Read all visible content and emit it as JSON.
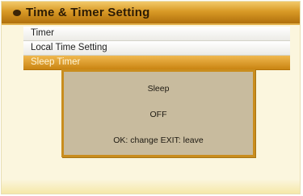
{
  "header": {
    "title": "Time & Timer Setting"
  },
  "menu": {
    "items": [
      {
        "label": "Timer"
      },
      {
        "label": "Local Time Setting"
      },
      {
        "label": "Sleep Timer"
      }
    ],
    "selected_index": 2
  },
  "popup": {
    "label": "Sleep",
    "value": "OFF",
    "hint": "OK: change  EXIT: leave"
  },
  "colors": {
    "accent": "#d99a26",
    "background": "#fbf6de",
    "popup_bg": "#c8bb9e",
    "popup_border": "#c98d1e"
  }
}
